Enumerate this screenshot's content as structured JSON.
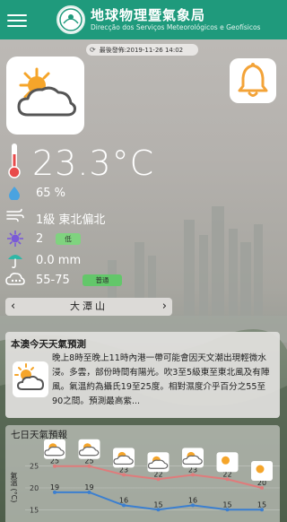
{
  "header": {
    "title_zh": "地球物理暨氣象局",
    "title_pt": "Direcção dos Serviços Meteorológicos e Geofísicos"
  },
  "update": {
    "text": "最後發佈:2019-11-26 14:02"
  },
  "current": {
    "temperature": "23.3°C",
    "humidity": "65 %",
    "wind": "1級 東北偏北",
    "uv_value": "2",
    "uv_level": "低",
    "rain": "0.0 mm",
    "aqi": "55-75",
    "aqi_level": "普通"
  },
  "station": {
    "name": "大潭山"
  },
  "forecast": {
    "title": "本澳今天天氣預測",
    "text": "晚上8時至晚上11時內港一帶可能會因天文潮出現輕微水浸。多雲，部份時間有陽光。吹3至5級東至東北風及有陣風。氣溫約為攝氏19至25度。相對濕度介乎百分之55至90之間。預測最高紫..."
  },
  "seven_day": {
    "title": "七日天氣預報",
    "ylabel": "氣溫 (°C)"
  },
  "chart_data": {
    "type": "line",
    "title": "七日天氣預報",
    "ylabel": "氣溫 (°C)",
    "yticks": [
      "25",
      "20",
      "15"
    ],
    "ylim": [
      13,
      27
    ],
    "x": [
      1,
      2,
      3,
      4,
      5,
      6,
      7
    ],
    "series": [
      {
        "values": [
          25,
          25,
          23,
          22,
          23,
          22,
          20
        ]
      },
      {
        "values": [
          19,
          19,
          16,
          15,
          16,
          15,
          15
        ]
      }
    ],
    "icons": [
      "sun-cloud",
      "sun-cloud",
      "sun-cloud",
      "sun-cloud",
      "sun-cloud",
      "sun",
      "sun"
    ]
  },
  "colors": {
    "header": "#1f9a7c",
    "high_line": "#e07b7b",
    "low_line": "#3b7fd0",
    "uv_pill": "#7fd37f",
    "aqi_pill": "#63c76a",
    "bell": "#f3a338",
    "sun": "#f5a52a"
  }
}
